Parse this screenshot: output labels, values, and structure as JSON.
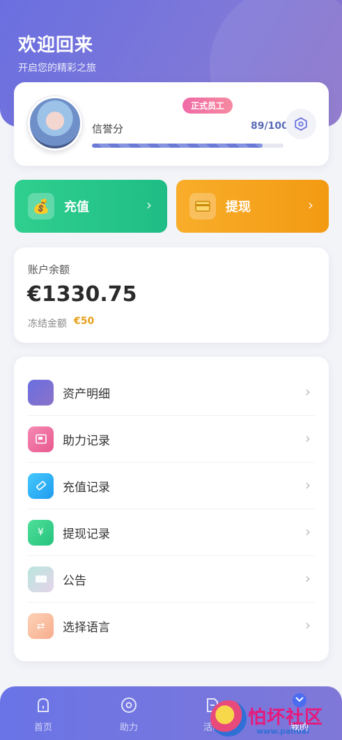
{
  "header": {
    "title": "欢迎回来",
    "subtitle": "开启您的精彩之旅"
  },
  "profile": {
    "badge": "正式员工",
    "credit_label": "信誉分",
    "credit_value": "89/100",
    "credit_fraction": 0.89
  },
  "actions": {
    "recharge_label": "充值",
    "withdraw_label": "提现"
  },
  "balance": {
    "label": "账户余额",
    "amount": "€1330.75",
    "frozen_label": "冻结金额",
    "frozen_value": "€50"
  },
  "menu": {
    "items": [
      {
        "label": "资产明细",
        "icon": "wallet-icon",
        "color": "#6f6bd8"
      },
      {
        "label": "助力记录",
        "icon": "picture-icon",
        "color": "#ef6aa5"
      },
      {
        "label": "充值记录",
        "icon": "ticket-icon",
        "color": "#2fb2f5"
      },
      {
        "label": "提现记录",
        "icon": "yen-box-icon",
        "color": "#35d08a"
      },
      {
        "label": "公告",
        "icon": "card-icon",
        "color": "#d8dbe6"
      },
      {
        "label": "选择语言",
        "icon": "swap-icon",
        "color": "#f8b994"
      }
    ]
  },
  "tabbar": {
    "tabs": [
      {
        "label": "首页"
      },
      {
        "label": "助力"
      },
      {
        "label": "活动"
      },
      {
        "label": "我的"
      }
    ]
  },
  "watermark": {
    "text": "怕坏社区",
    "url": "www.pahuai"
  },
  "colors": {
    "accent": "#6b74e0",
    "recharge": "#22c48a",
    "withdraw": "#f5a01c",
    "frozen": "#e6a11a"
  }
}
